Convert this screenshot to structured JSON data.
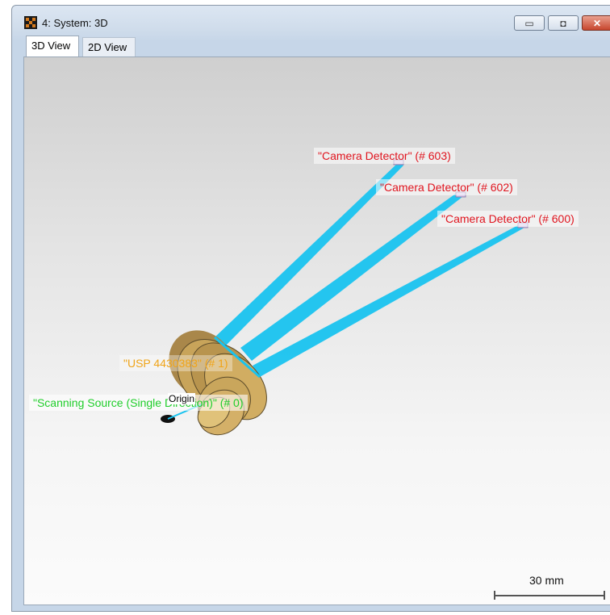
{
  "window": {
    "title": "4: System: 3D",
    "controls": {
      "minimize": "▭",
      "restore": "◘",
      "close": "✕"
    }
  },
  "tabs": [
    {
      "label": "3D View",
      "active": true
    },
    {
      "label": "2D View",
      "active": false
    }
  ],
  "scene": {
    "labels": {
      "detector_603": "\"Camera Detector\" (# 603)",
      "detector_602": "\"Camera Detector\" (# 602)",
      "detector_600": "\"Camera Detector\" (# 600)",
      "lens": "\"USP 4430383\" (# 1)",
      "source": "\"Scanning Source (Single Direction)\" (# 0)",
      "origin": "Origin"
    },
    "colors": {
      "ray": "#19c3ef",
      "lens": "#c8a45a",
      "detector_label": "#e0141e",
      "lens_label": "#f0a418",
      "source_label": "#1fce2a"
    }
  },
  "scale_bar": {
    "label": "30 mm"
  }
}
